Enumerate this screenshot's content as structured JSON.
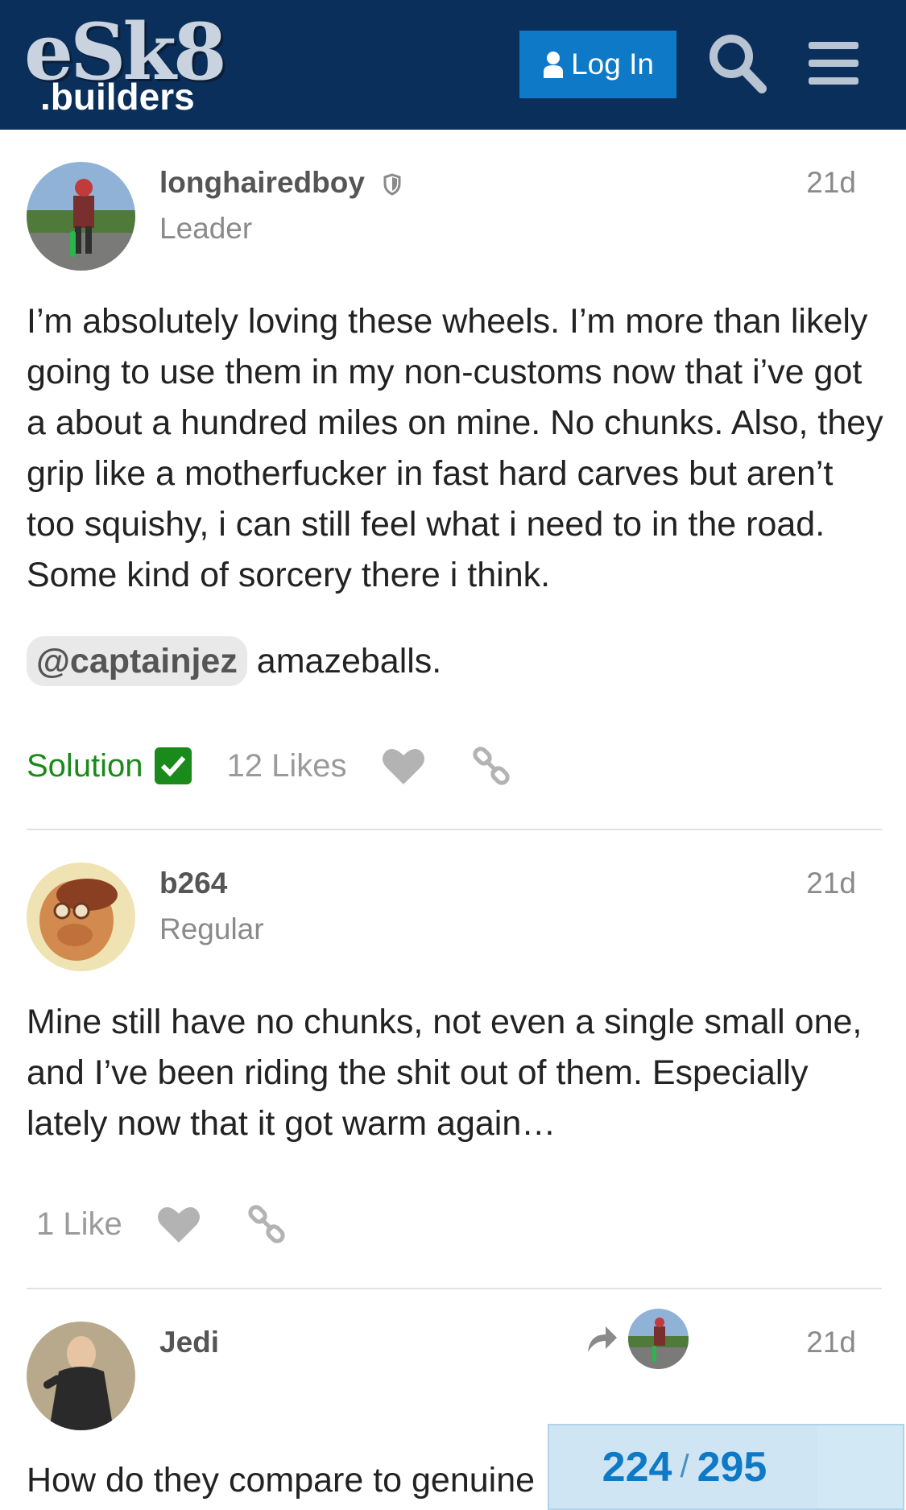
{
  "header": {
    "logo_main": "eSk8",
    "logo_sub": ".builders",
    "login_label": "Log In",
    "background": "#0a2f5a",
    "accent": "#0e79c7"
  },
  "posts": [
    {
      "username": "longhairedboy",
      "role": "Leader",
      "date": "21d",
      "body": "I’m absolutely loving these wheels. I’m more than likely going to use them in my non-customs now that i’ve got a about a hundred miles on mine. No chunks. Also, they grip like a motherfucker in fast hard carves but aren’t too squishy, i can still feel what i need to in the road. Some kind of sorcery there i think.",
      "mention": "@captainjez",
      "mention_after": "amazeballs.",
      "solution_label": "Solution",
      "likes": "12 Likes"
    },
    {
      "username": "b264",
      "role": "Regular",
      "date": "21d",
      "body": "Mine still have no chunks, not even a single small one, and I’ve been riding the shit out of them. Especially lately now that it got warm again…",
      "likes": "1 Like"
    },
    {
      "username": "Jedi",
      "date": "21d",
      "body": "How do they compare to genuine"
    }
  ],
  "progress": {
    "current": "224",
    "separator": "/",
    "total": "295",
    "fraction": 0.759
  },
  "icons": {
    "shield": "shield-icon",
    "heart": "heart-icon",
    "link": "link-icon",
    "reply": "reply-arrow-icon",
    "search": "search-icon",
    "menu": "hamburger-menu-icon"
  }
}
